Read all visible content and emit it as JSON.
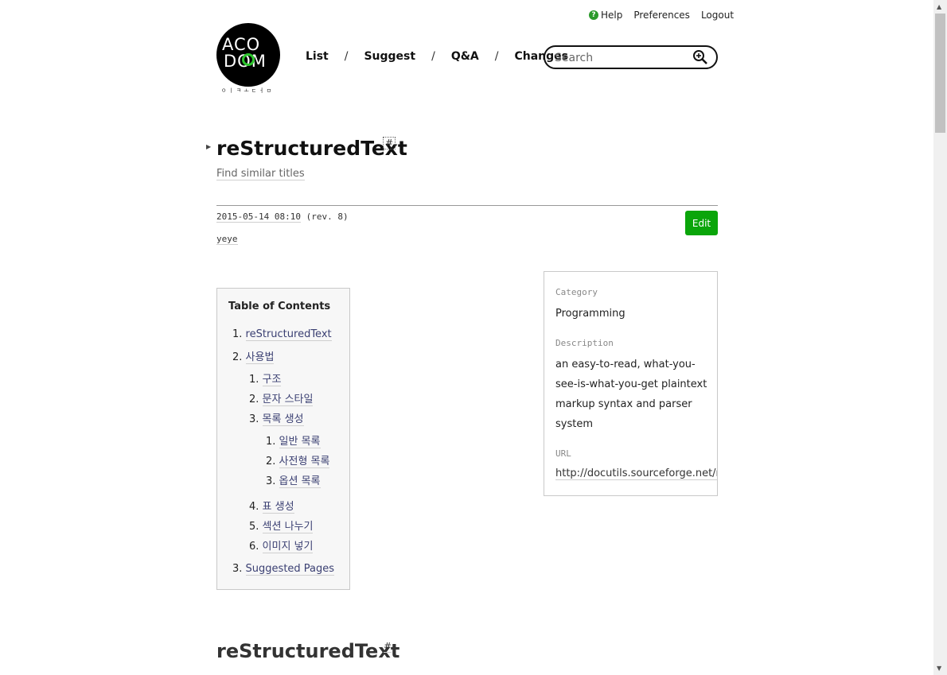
{
  "toplinks": {
    "help": "Help",
    "preferences": "Preferences",
    "logout": "Logout"
  },
  "logo": {
    "line1": "ACO",
    "line2": "DOM",
    "sub": "ㅇㅣㅋㅗㄷㅓㅁ"
  },
  "nav": {
    "list": "List",
    "suggest": "Suggest",
    "qa": "Q&A",
    "changes": "Changes",
    "sep": "/"
  },
  "search": {
    "placeholder": "Search"
  },
  "page": {
    "title": "reStructuredText",
    "anchor": "#",
    "similar": "Find similar titles",
    "timestamp": "2015-05-14 08:10",
    "revision": "(rev. 8)",
    "author": "yeye",
    "edit": "Edit"
  },
  "toc": {
    "heading": "Table of Contents",
    "items": [
      {
        "num": "1.",
        "label": "reStructuredText"
      },
      {
        "num": "2.",
        "label": "사용법"
      },
      {
        "num": "1.",
        "label": "구조"
      },
      {
        "num": "2.",
        "label": "문자 스타일"
      },
      {
        "num": "3.",
        "label": "목록 생성"
      },
      {
        "num": "1.",
        "label": "일반 목록"
      },
      {
        "num": "2.",
        "label": "사전형 목록"
      },
      {
        "num": "3.",
        "label": "옵션 목록"
      },
      {
        "num": "4.",
        "label": "표 생성"
      },
      {
        "num": "5.",
        "label": "섹션 나누기"
      },
      {
        "num": "6.",
        "label": "이미지 넣기"
      },
      {
        "num": "3.",
        "label": "Suggested Pages"
      }
    ]
  },
  "infobox": {
    "category_label": "Category",
    "category": "Programming",
    "description_label": "Description",
    "description": "an easy-to-read, what-you-see-is-what-you-get plaintext markup syntax and parser system",
    "url_label": "URL",
    "url": "http://docutils.sourceforge.net/rst.html"
  },
  "section": {
    "heading": "reStructuredText",
    "anchor": "#"
  },
  "colors": {
    "accent_green": "#0aa50a",
    "link": "#3a3f72"
  }
}
